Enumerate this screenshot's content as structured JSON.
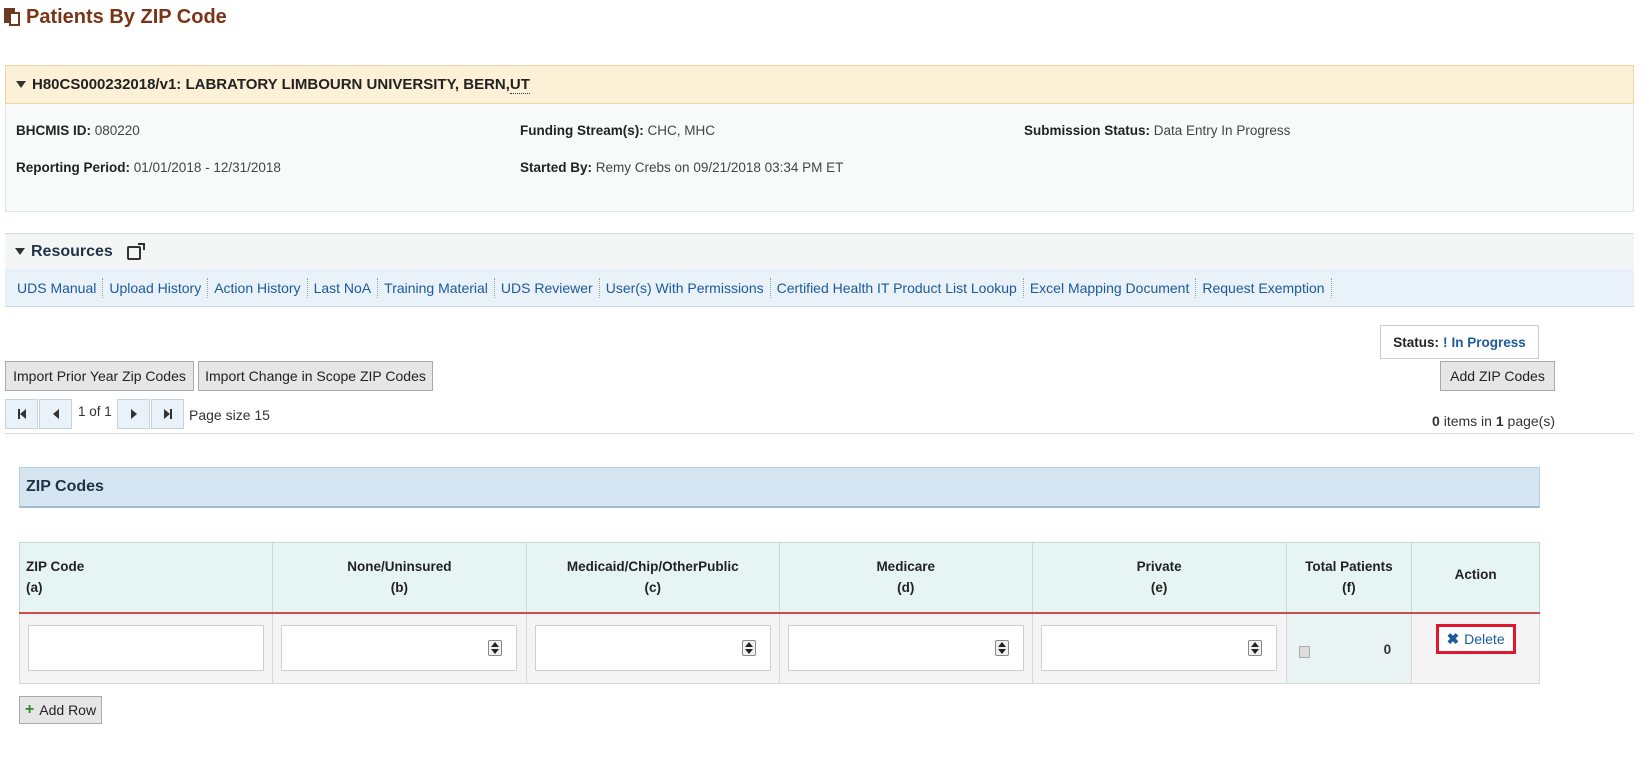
{
  "page": {
    "title": "Patients By ZIP Code"
  },
  "grant": {
    "header": "H80CS000232018/v1: LABRATORY LIMBOURN UNIVERSITY, BERN, ",
    "state": "UT",
    "bhcmis_label": "BHCMIS ID:",
    "bhcmis_value": "080220",
    "funding_label": "Funding Stream(s):",
    "funding_value": "CHC, MHC",
    "submission_label": "Submission Status:",
    "submission_value": "Data Entry In Progress",
    "reporting_label": "Reporting Period:",
    "reporting_value": "01/01/2018 - 12/31/2018",
    "started_label": "Started By:",
    "started_value": "Remy Crebs on 09/21/2018 03:34 PM ET"
  },
  "resources": {
    "title": "Resources",
    "links": [
      "UDS Manual",
      "Upload History",
      "Action History",
      "Last NoA",
      "Training Material",
      "UDS Reviewer",
      "User(s) With Permissions",
      "Certified Health IT Product List Lookup",
      "Excel Mapping Document",
      "Request Exemption"
    ]
  },
  "status": {
    "label": "Status:",
    "mark": "!",
    "value": "In Progress"
  },
  "toolbar": {
    "import_prior": "Import Prior Year Zip Codes",
    "import_scope": "Import Change in Scope ZIP Codes",
    "add_zip": "Add ZIP Codes"
  },
  "pager": {
    "position": "1 of 1",
    "page_size": "Page size 15",
    "items_count": "0",
    "items_mid": " items in ",
    "pages_count": "1",
    "items_suffix": " page(s)"
  },
  "zip_section": {
    "title": "ZIP Codes",
    "columns": [
      {
        "name": "ZIP Code",
        "code": "(a)"
      },
      {
        "name": "None/Uninsured",
        "code": "(b)"
      },
      {
        "name": "Medicaid/Chip/OtherPublic",
        "code": "(c)"
      },
      {
        "name": "Medicare",
        "code": "(d)"
      },
      {
        "name": "Private",
        "code": "(e)"
      },
      {
        "name": "Total Patients",
        "code": "(f)"
      },
      {
        "name": "Action",
        "code": ""
      }
    ],
    "row": {
      "total": "0",
      "delete_label": "Delete"
    },
    "add_row_label": "Add Row"
  },
  "colors": {
    "title": "#7a3416",
    "link": "#1d5a9c",
    "highlight": "#e0182d"
  }
}
